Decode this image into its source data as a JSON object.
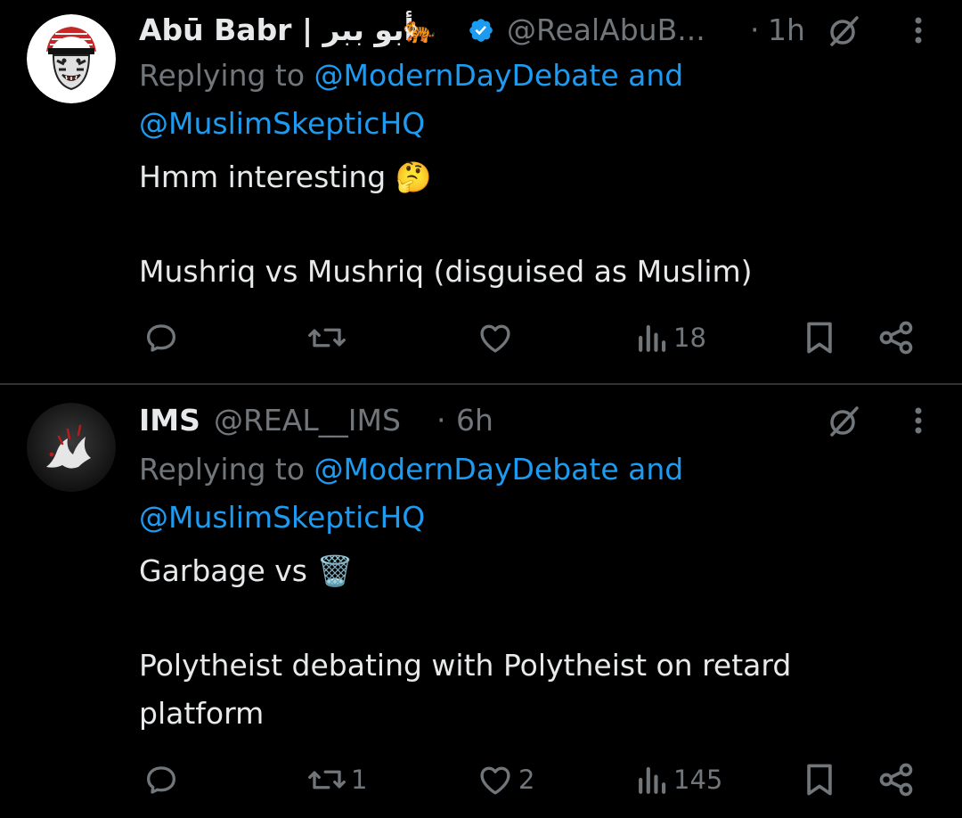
{
  "tweets": [
    {
      "name": "Abū Babr | أبو ببر",
      "name_emoji": "🐅",
      "handle": "@RealAbuB...",
      "separator": "·",
      "time": "1h",
      "replying_prefix": "Replying to",
      "replying_to_1": "@ModernDayDebate",
      "replying_joiner": "and",
      "replying_to_2": "@MuslimSkepticHQ",
      "body_line_1": "Hmm interesting 🤔",
      "body_line_2": "Mushriq vs Mushriq (disguised as Muslim)",
      "body_line_3": "",
      "counts": {
        "replies": "",
        "reposts": "",
        "likes": "",
        "views": "18"
      }
    },
    {
      "name": "IMS",
      "handle": "@REAL__IMS",
      "separator": "·",
      "time": "6h",
      "replying_prefix": "Replying to",
      "replying_to_1": "@ModernDayDebate",
      "replying_joiner": "and",
      "replying_to_2": "@MuslimSkepticHQ",
      "body_line_1": "Garbage vs 🗑️",
      "body_line_2": "Polytheist debating with Polytheist on retard",
      "body_line_3": "platform",
      "counts": {
        "replies": "",
        "reposts": "1",
        "likes": "2",
        "views": "145"
      }
    }
  ],
  "colors": {
    "background": "#000000",
    "text": "#e7e9ea",
    "muted": "#71767b",
    "link": "#1d9bf0",
    "verified": "#1d9bf0",
    "divider": "#2f3336"
  },
  "icons": {
    "reply": "reply-icon",
    "repost": "repost-icon",
    "like": "heart-icon",
    "views": "views-icon",
    "bookmark": "bookmark-icon",
    "share": "share-icon",
    "grok": "grok-icon",
    "more": "more-options-icon",
    "verified": "verified-badge-icon"
  }
}
